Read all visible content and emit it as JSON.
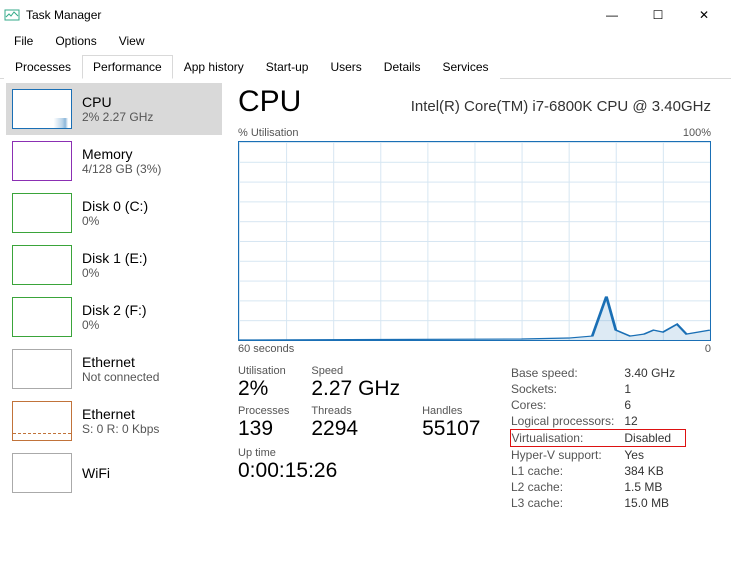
{
  "window": {
    "title": "Task Manager",
    "minimize": "—",
    "maximize": "☐",
    "close": "✕"
  },
  "menu": {
    "file": "File",
    "options": "Options",
    "view": "View"
  },
  "tabs": {
    "processes": "Processes",
    "performance": "Performance",
    "apphistory": "App history",
    "startup": "Start-up",
    "users": "Users",
    "details": "Details",
    "services": "Services"
  },
  "sidebar": {
    "items": [
      {
        "name": "CPU",
        "sub": "2% 2.27 GHz",
        "cls": "cpu"
      },
      {
        "name": "Memory",
        "sub": "4/128 GB (3%)",
        "cls": "mem"
      },
      {
        "name": "Disk 0 (C:)",
        "sub": "0%",
        "cls": "disk"
      },
      {
        "name": "Disk 1 (E:)",
        "sub": "0%",
        "cls": "disk"
      },
      {
        "name": "Disk 2 (F:)",
        "sub": "0%",
        "cls": "disk"
      },
      {
        "name": "Ethernet",
        "sub": "Not connected",
        "cls": "eth1"
      },
      {
        "name": "Ethernet",
        "sub": "S: 0 R: 0 Kbps",
        "cls": "eth2"
      },
      {
        "name": "WiFi",
        "sub": "",
        "cls": "misc"
      }
    ]
  },
  "cpu": {
    "title": "CPU",
    "model": "Intel(R) Core(TM) i7-6800K CPU @ 3.40GHz",
    "chart_ylabel": "% Utilisation",
    "chart_ymax": "100%",
    "chart_xleft": "60 seconds",
    "chart_xright": "0",
    "stats": {
      "util_label": "Utilisation",
      "util": "2%",
      "speed_label": "Speed",
      "speed": "2.27 GHz",
      "proc_label": "Processes",
      "proc": "139",
      "thr_label": "Threads",
      "thr": "2294",
      "hnd_label": "Handles",
      "hnd": "55107",
      "uptime_label": "Up time",
      "uptime": "0:00:15:26"
    },
    "details": {
      "base_label": "Base speed:",
      "base": "3.40 GHz",
      "sockets_label": "Sockets:",
      "sockets": "1",
      "cores_label": "Cores:",
      "cores": "6",
      "lp_label": "Logical processors:",
      "lp": "12",
      "virt_label": "Virtualisation:",
      "virt": "Disabled",
      "hv_label": "Hyper-V support:",
      "hv": "Yes",
      "l1_label": "L1 cache:",
      "l1": "384 KB",
      "l2_label": "L2 cache:",
      "l2": "1.5 MB",
      "l3_label": "L3 cache:",
      "l3": "15.0 MB"
    }
  },
  "chart_data": {
    "type": "line",
    "title": "CPU % Utilisation",
    "xlabel": "seconds",
    "ylabel": "% Utilisation",
    "xlim": [
      0,
      60
    ],
    "ylim": [
      0,
      100
    ],
    "x": [
      60,
      55,
      50,
      45,
      40,
      35,
      30,
      25,
      20,
      15,
      12,
      10,
      8,
      6,
      5,
      4,
      3,
      2,
      1,
      0
    ],
    "values": [
      0,
      0,
      0,
      0,
      0,
      0,
      0,
      0,
      0,
      1,
      2,
      22,
      5,
      2,
      3,
      5,
      4,
      8,
      3,
      5
    ]
  }
}
